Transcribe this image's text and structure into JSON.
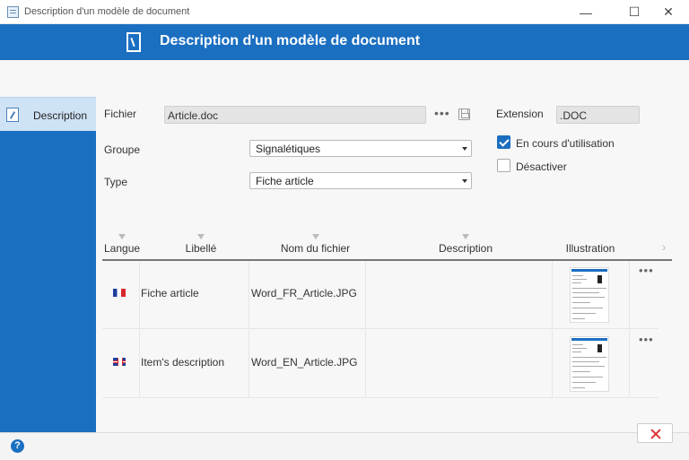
{
  "window": {
    "title": "Description d'un modèle de document",
    "minimize": "—",
    "maximize": "☐",
    "close": "✕"
  },
  "header": {
    "title": "Description d'un modèle de document"
  },
  "sidebar": {
    "items": [
      {
        "label": "Description",
        "selected": true
      }
    ]
  },
  "form": {
    "fichier": {
      "label": "Fichier",
      "value": "Article.doc"
    },
    "extension": {
      "label": "Extension",
      "value": ".DOC"
    },
    "groupe": {
      "label": "Groupe",
      "value": "Signalétiques"
    },
    "type": {
      "label": "Type",
      "value": "Fiche article"
    },
    "en_cours": {
      "label": "En cours d'utilisation",
      "checked": true
    },
    "desactiver": {
      "label": "Désactiver",
      "checked": false
    },
    "more": "•••"
  },
  "table": {
    "columns": [
      "Langue",
      "Libellé",
      "Nom du fichier",
      "Description",
      "Illustration"
    ],
    "rows": [
      {
        "flag": "fr-flag-icon",
        "libelle": "Fiche article",
        "fichier": "Word_FR_Article.JPG",
        "description": "",
        "more": "•••"
      },
      {
        "flag": "gb-flag-icon",
        "libelle": "Item's description",
        "fichier": "Word_EN_Article.JPG",
        "description": "",
        "more": "•••"
      }
    ],
    "scroll_right": "›"
  },
  "footer": {
    "help": "?"
  },
  "colors": {
    "accent": "#1b6fc1",
    "close_red": "#d33333"
  }
}
